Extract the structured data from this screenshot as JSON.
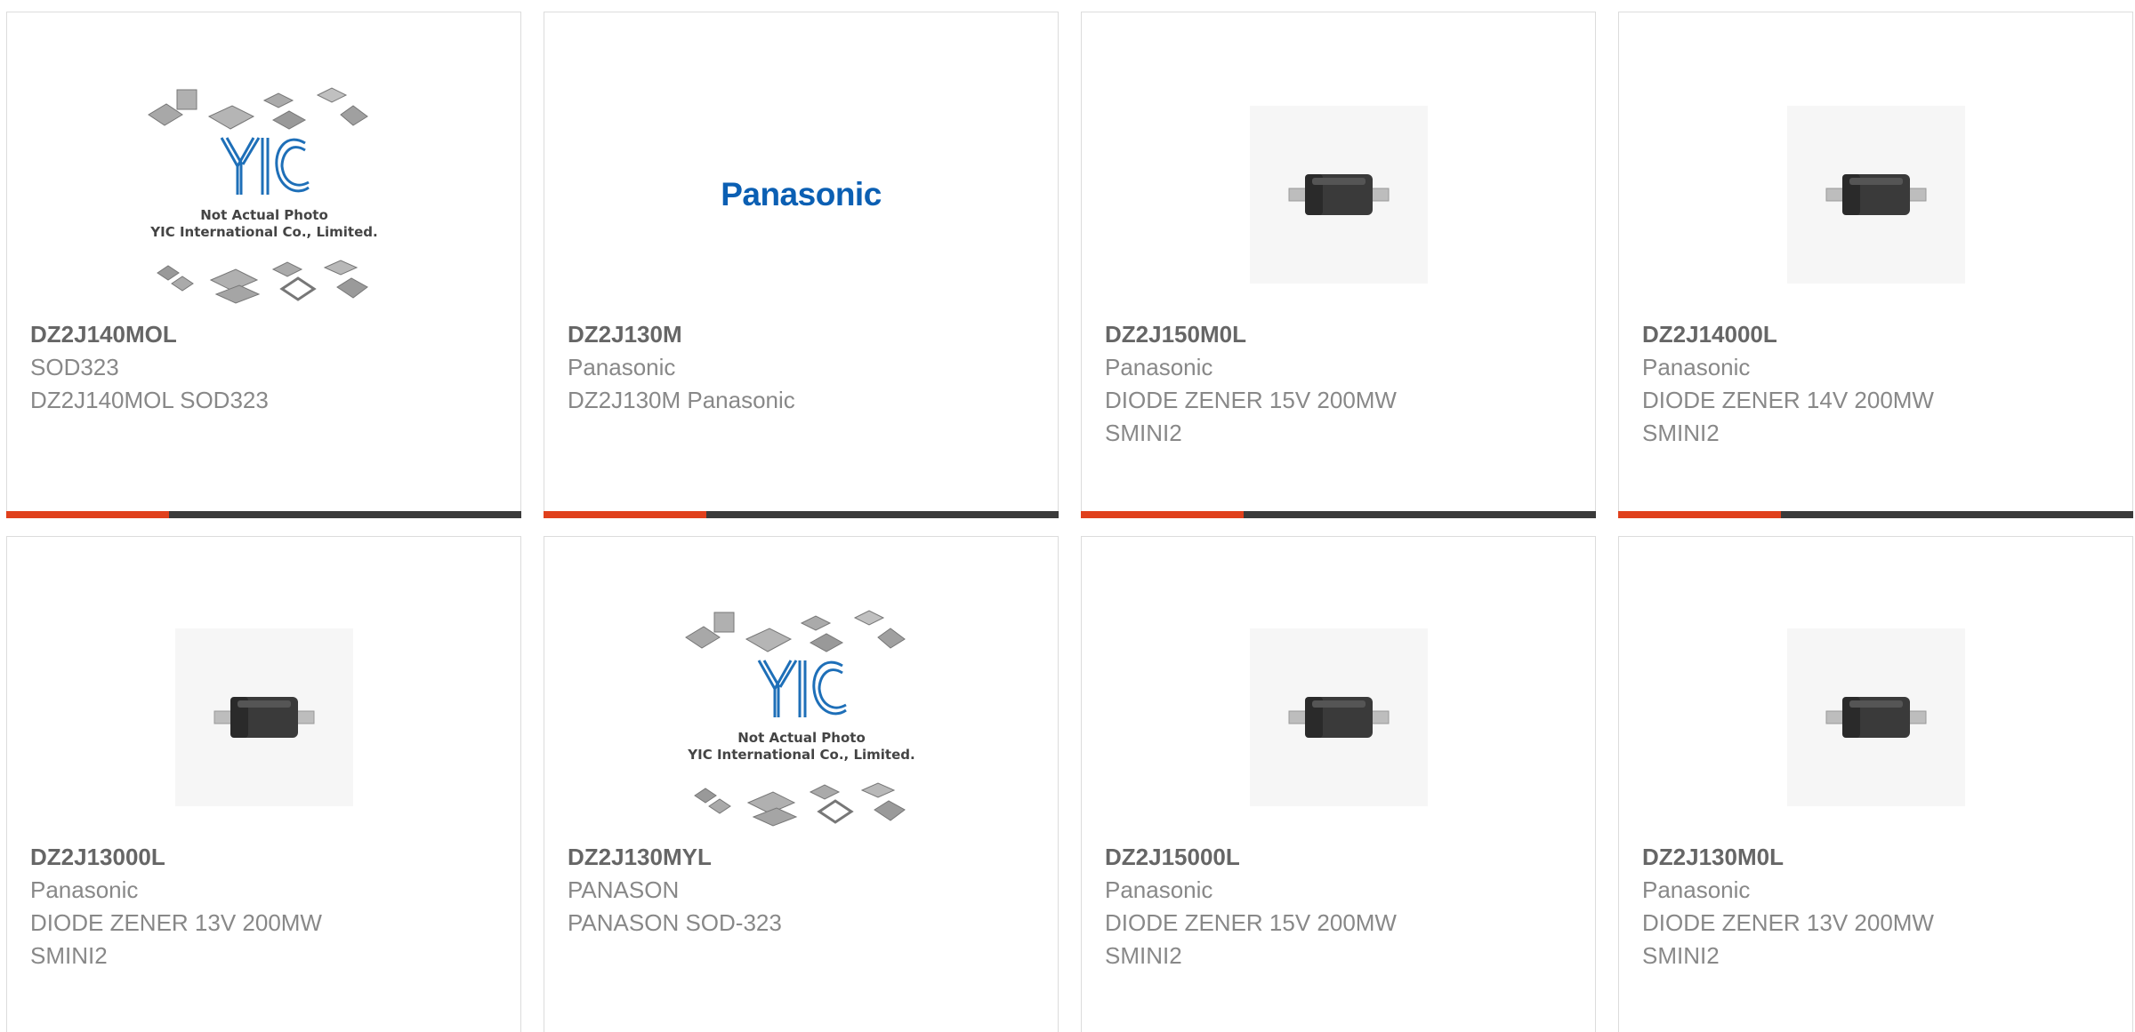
{
  "products": [
    {
      "part": "DZ2J140MOL",
      "manufacturer": "SOD323",
      "description": "DZ2J140MOL SOD323",
      "image": "yic-placeholder",
      "placeholder_lines": [
        "Not Actual Photo",
        "YIC International Co., Limited."
      ],
      "logo_text": "YIC"
    },
    {
      "part": "DZ2J130M",
      "manufacturer": "Panasonic",
      "description": "DZ2J130M Panasonic",
      "image": "panasonic-logo",
      "logo_text": "Panasonic"
    },
    {
      "part": "DZ2J150M0L",
      "manufacturer": "Panasonic",
      "description": "DIODE ZENER 15V 200MW SMINI2",
      "image": "diode-photo"
    },
    {
      "part": "DZ2J14000L",
      "manufacturer": "Panasonic",
      "description": "DIODE ZENER 14V 200MW SMINI2",
      "image": "diode-photo"
    },
    {
      "part": "DZ2J13000L",
      "manufacturer": "Panasonic",
      "description": "DIODE ZENER 13V 200MW SMINI2",
      "image": "diode-photo"
    },
    {
      "part": "DZ2J130MYL",
      "manufacturer": "PANASON",
      "description": "PANASON SOD-323",
      "image": "yic-placeholder",
      "placeholder_lines": [
        "Not Actual Photo",
        "YIC International Co., Limited."
      ],
      "logo_text": "YIC"
    },
    {
      "part": "DZ2J15000L",
      "manufacturer": "Panasonic",
      "description": "DIODE ZENER 15V 200MW SMINI2",
      "image": "diode-photo"
    },
    {
      "part": "DZ2J130M0L",
      "manufacturer": "Panasonic",
      "description": "DIODE ZENER 13V 200MW SMINI2",
      "image": "diode-photo"
    }
  ],
  "colors": {
    "accent": "#e0401c",
    "bar": "#3a3a3a",
    "panasonic_blue": "#0b5fb3",
    "yic_blue": "#1e6fb8"
  }
}
